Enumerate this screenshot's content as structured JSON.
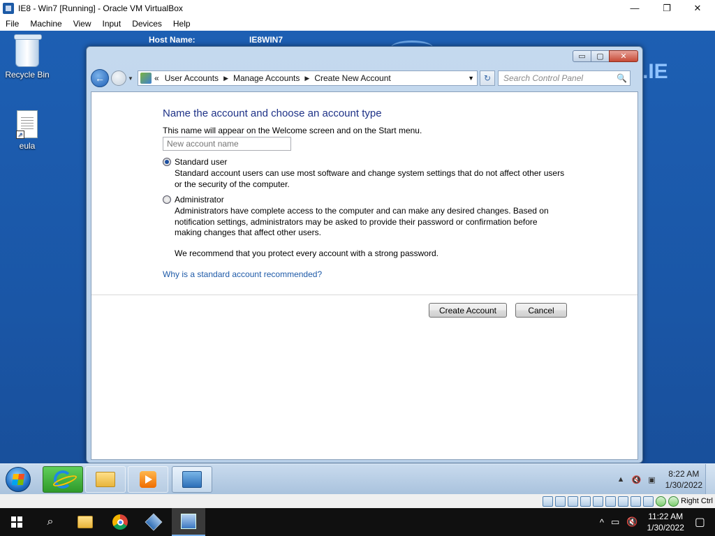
{
  "host_window": {
    "title": "IE8 - Win7 [Running] - Oracle VM VirtualBox",
    "controls": {
      "minimize": "—",
      "maximize": "❐",
      "close": "✕"
    },
    "menu": [
      "File",
      "Machine",
      "View",
      "Input",
      "Devices",
      "Help"
    ]
  },
  "desktop": {
    "host_name_label": "Host Name:",
    "host_name_value": "IE8WIN7",
    "brand_text": ".IE",
    "icons": [
      {
        "label": "Recycle Bin"
      },
      {
        "label": "eula"
      }
    ]
  },
  "cp_window": {
    "controls": {
      "minimize": "▭",
      "maximize": "▢",
      "close": "✕"
    },
    "nav": {
      "back": "←",
      "drop": "▼"
    },
    "breadcrumb": {
      "overflow": "«",
      "items": [
        "User Accounts",
        "Manage Accounts",
        "Create New Account"
      ],
      "separator": "▶"
    },
    "refresh": "↻",
    "search": {
      "placeholder": "Search Control Panel",
      "icon": "🔍"
    },
    "content": {
      "heading": "Name the account and choose an account type",
      "description": "This name will appear on the Welcome screen and on the Start menu.",
      "name_input": {
        "value": "",
        "placeholder": "New account name"
      },
      "options": [
        {
          "label": "Standard user",
          "selected": true,
          "description": "Standard account users can use most software and change system settings that do not affect other users or the security of the computer."
        },
        {
          "label": "Administrator",
          "selected": false,
          "description": "Administrators have complete access to the computer and can make any desired changes. Based on notification settings, administrators may be asked to provide their password or confirmation before making changes that affect other users."
        }
      ],
      "recommendation": "We recommend that you protect every account with a strong password.",
      "help_link": "Why is a standard account recommended?",
      "create_button": "Create Account",
      "cancel_button": "Cancel"
    }
  },
  "guest_taskbar": {
    "tray_arrow": "▲",
    "tray_volume": "🔇",
    "tray_network": "▣",
    "time": "8:22 AM",
    "date": "1/30/2022"
  },
  "vbox_status": {
    "host_key": "Right Ctrl"
  },
  "host_taskbar": {
    "search_icon": "⌕",
    "tray_arrow": "^",
    "tray_network": "▭",
    "tray_volume": "🔇",
    "notification_icon": "▢",
    "time": "11:22 AM",
    "date": "1/30/2022"
  }
}
